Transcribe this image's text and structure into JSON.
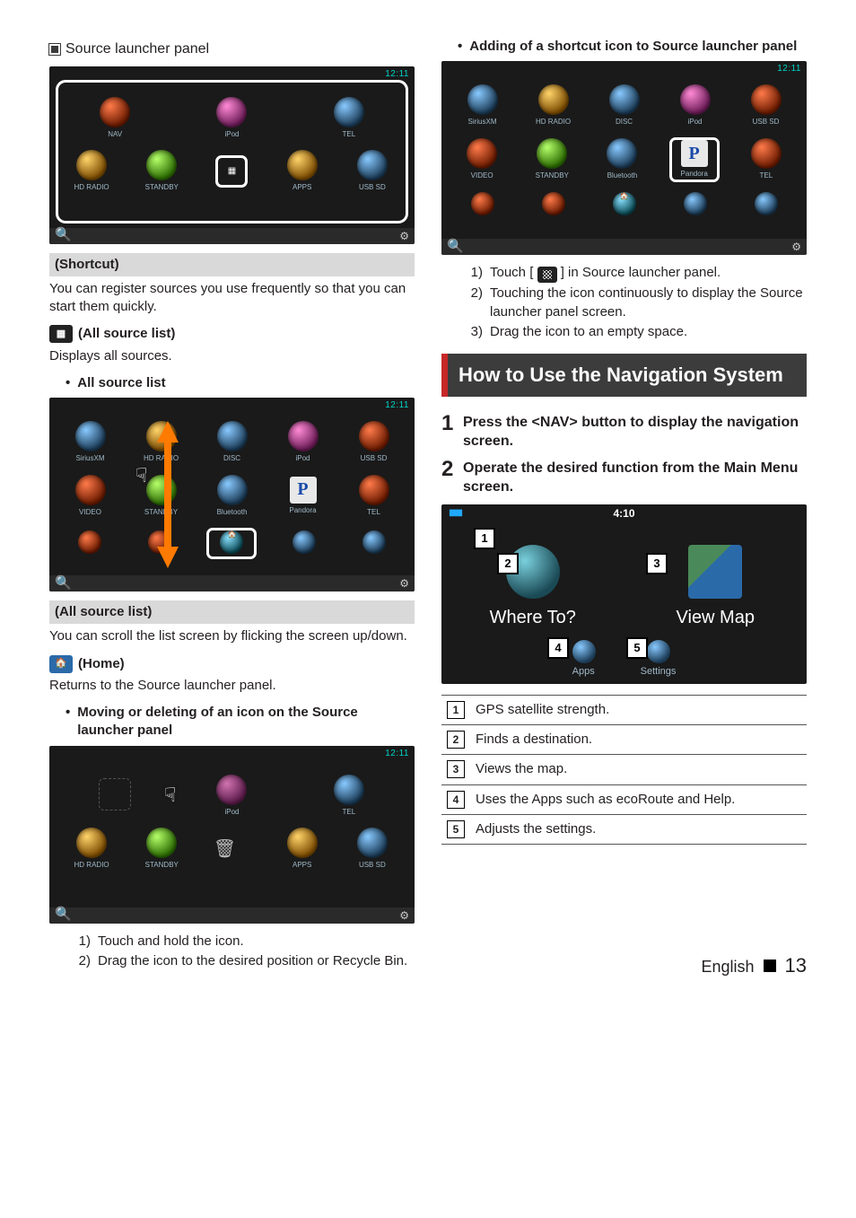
{
  "left": {
    "h_panel": "Source launcher panel",
    "shot1": {
      "time": "12:11",
      "row1": [
        "NAV",
        "iPod",
        "TEL"
      ],
      "row2": [
        "HD RADIO",
        "STANDBY",
        "",
        "APPS",
        "USB SD"
      ]
    },
    "shortcut_hd": "(Shortcut)",
    "shortcut_txt": "You can register sources you use frequently so that you can start them quickly.",
    "allsrc_hd": "(All source list)",
    "allsrc_txt": "Displays all sources.",
    "bullet_allsrc": "All source list",
    "shot2": {
      "time": "12:11",
      "row1": [
        "SiriusXM",
        "HD RADIO",
        "DISC",
        "iPod",
        "USB SD"
      ],
      "row2": [
        "VIDEO",
        "STANDBY",
        "Bluetooth",
        "Pandora",
        "TEL"
      ]
    },
    "allsrc_list_hd": "(All source list)",
    "allsrc_list_txt": "You can scroll the list screen by flicking the screen up/down.",
    "home_hd": "(Home)",
    "home_txt": "Returns to the Source launcher panel.",
    "bullet_move": "Moving or deleting of an icon on the Source launcher panel",
    "shot3": {
      "time": "12:11",
      "row1": [
        "",
        "iPod",
        "TEL"
      ],
      "row2": [
        "HD RADIO",
        "STANDBY",
        "🗑",
        "APPS",
        "USB SD"
      ]
    },
    "move_steps": [
      "Touch and hold the icon.",
      "Drag the icon to the desired position or Recycle Bin."
    ]
  },
  "right": {
    "bullet_add": "Adding of a shortcut icon to Source launcher panel",
    "shot4": {
      "time": "12:11",
      "row1": [
        "SiriusXM",
        "HD RADIO",
        "DISC",
        "iPod",
        "USB SD"
      ],
      "row2": [
        "VIDEO",
        "STANDBY",
        "Bluetooth",
        "Pandora",
        "TEL"
      ]
    },
    "add_steps": {
      "s1_a": "Touch [",
      "s1_b": "] in Source launcher panel.",
      "s2": "Touching the icon continuously to display the Source launcher panel screen.",
      "s3": "Drag the icon to an empty space."
    },
    "nav_hd": "How to Use the Navigation System",
    "step1": "Press the <NAV> button to display the navigation screen.",
    "step2": "Operate the desired function from the Main Menu screen.",
    "navshot": {
      "clock": "4:10",
      "where": "Where To?",
      "view": "View Map",
      "apps": "Apps",
      "settings": "Settings"
    },
    "legend": [
      "GPS satellite strength.",
      "Finds a destination.",
      "Views the map.",
      "Uses the Apps such as ecoRoute and Help.",
      "Adjusts the settings."
    ]
  },
  "footer": {
    "lang": "English",
    "page": "13"
  }
}
